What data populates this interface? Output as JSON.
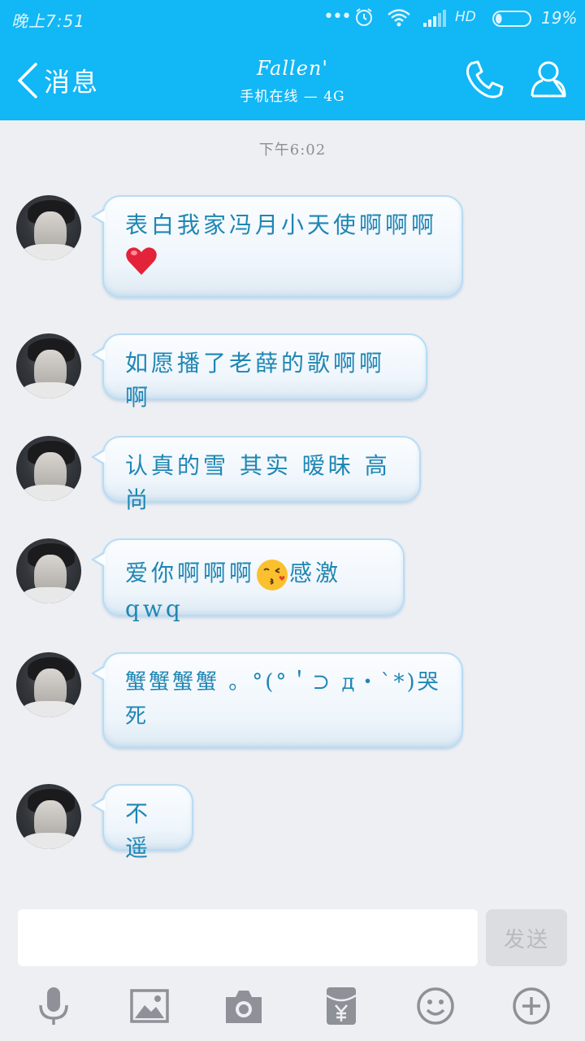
{
  "status_bar": {
    "time": "晚上7:51",
    "dots": "•••",
    "network": "HD",
    "battery": "19%",
    "battery_level": 0.19
  },
  "header": {
    "back_label": "消息",
    "contact_name": "Fallen'",
    "contact_status": "手机在线 — 4G"
  },
  "chat": {
    "timestamp": "下午6:02",
    "messages": [
      {
        "line1": "表白我家冯月小天使啊啊啊",
        "emoji": "heart"
      },
      {
        "text": "如愿播了老薛的歌啊啊啊"
      },
      {
        "text": "认真的雪 其实 暧昧 高尚"
      },
      {
        "before": "爱你啊啊啊",
        "emoji": "kiss",
        "after": "感激qwq"
      },
      {
        "line1": "蟹蟹蟹蟹 。°(°＇⊃ д・`*)哭",
        "line2": "死"
      },
      {
        "text": "不遥"
      }
    ]
  },
  "input": {
    "value": "",
    "send_label": "发送"
  },
  "toolbar": {
    "icons": [
      "microphone-icon",
      "image-icon",
      "camera-icon",
      "red-packet-icon",
      "emoji-icon",
      "plus-icon"
    ]
  },
  "colors": {
    "header_bg": "#12b7f5",
    "bubble_text": "#1f86b4",
    "bubble_border": "#b8dcf4",
    "chat_bg": "#eeeff3"
  }
}
